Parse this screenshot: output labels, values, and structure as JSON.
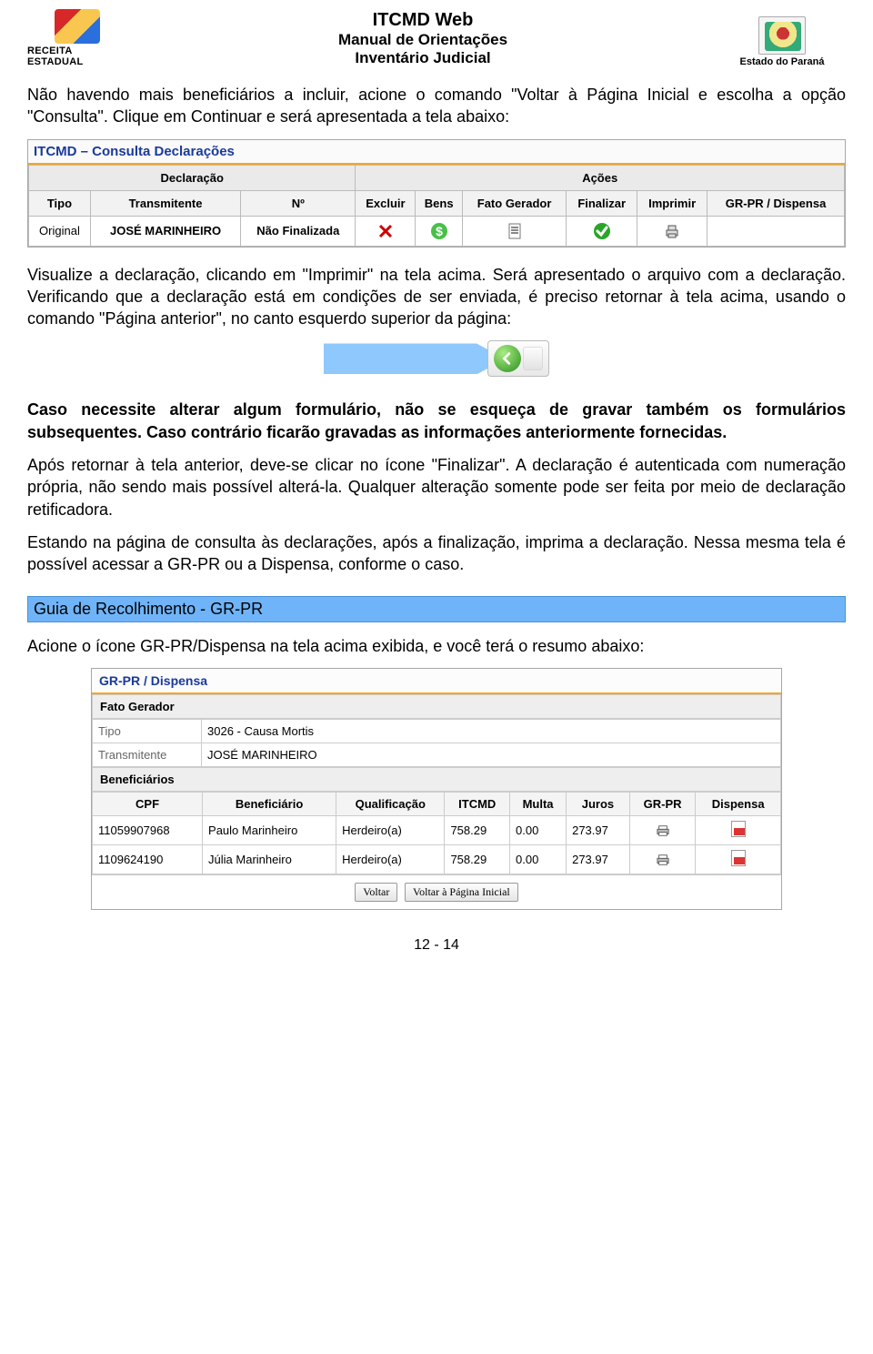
{
  "header": {
    "left_label": "RECEITA ESTADUAL",
    "title1": "ITCMD Web",
    "title2": "Manual de Orientações",
    "title3": "Inventário Judicial",
    "right_label": "Estado do Paraná"
  },
  "para1": "Não havendo mais beneficiários a incluir, acione o comando \"Voltar à Página Inicial e escolha a opção \"Consulta\". Clique em Continuar e será apresentada a tela abaixo:",
  "screenshot1": {
    "panel_title": "ITCMD – Consulta Declarações",
    "group1": "Declaração",
    "group2": "Ações",
    "col_tipo": "Tipo",
    "col_transmitente": "Transmitente",
    "col_n": "Nº",
    "col_excluir": "Excluir",
    "col_bens": "Bens",
    "col_fato": "Fato Gerador",
    "col_finalizar": "Finalizar",
    "col_imprimir": "Imprimir",
    "col_grpr": "GR-PR / Dispensa",
    "row_tipo": "Original",
    "row_trans": "JOSÉ MARINHEIRO",
    "row_n": "Não Finalizada"
  },
  "para2": "Visualize a declaração, clicando em \"Imprimir\" na tela acima. Será apresentado o arquivo com a declaração. Verificando que a declaração está em condições de ser enviada, é preciso retornar à tela acima, usando o comando \"Página anterior\", no canto esquerdo superior da página:",
  "para3": "Caso necessite alterar algum formulário, não se esqueça de gravar também os formulários subsequentes. Caso contrário ficarão gravadas as informações anteriormente fornecidas.",
  "para4": "Após retornar à tela anterior, deve-se clicar no ícone \"Finalizar\". A declaração é autenticada com numeração própria, não sendo mais possível alterá-la. Qualquer alteração somente pode ser feita por meio de declaração retificadora.",
  "para5": "Estando na página de consulta às declarações, após a finalização, imprima a declaração. Nessa mesma tela é possível acessar a GR-PR ou a Dispensa, conforme o caso.",
  "section_bar": "Guia de Recolhimento - GR-PR",
  "para6": "Acione o ícone GR-PR/Dispensa na tela acima exibida,  e você terá o resumo abaixo:",
  "screenshot2": {
    "title": "GR-PR / Dispensa",
    "sub1": "Fato Gerador",
    "tipo_label": "Tipo",
    "tipo_value": "3026 - Causa Mortis",
    "trans_label": "Transmitente",
    "trans_value": "JOSÉ MARINHEIRO",
    "sub2": "Beneficiários",
    "cols": {
      "cpf": "CPF",
      "ben": "Beneficiário",
      "qual": "Qualificação",
      "itcmd": "ITCMD",
      "multa": "Multa",
      "juros": "Juros",
      "grpr": "GR-PR",
      "disp": "Dispensa"
    },
    "rows": [
      {
        "cpf": "11059907968",
        "ben": "Paulo Marinheiro",
        "qual": "Herdeiro(a)",
        "itcmd": "758.29",
        "multa": "0.00",
        "juros": "273.97"
      },
      {
        "cpf": "1109624190",
        "ben": "Júlia Marinheiro",
        "qual": "Herdeiro(a)",
        "itcmd": "758.29",
        "multa": "0.00",
        "juros": "273.97"
      }
    ],
    "btn_voltar": "Voltar",
    "btn_inicial": "Voltar à Página Inicial"
  },
  "footer": "12 - 14"
}
